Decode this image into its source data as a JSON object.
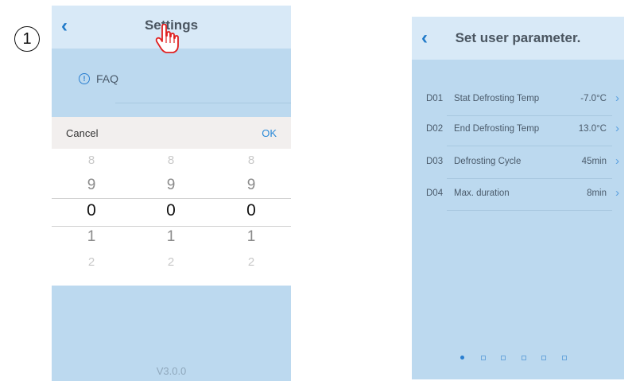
{
  "step_number": "1",
  "left_screen": {
    "title": "Settings",
    "faq_label": "FAQ",
    "picker": {
      "cancel_label": "Cancel",
      "ok_label": "OK",
      "wheels": [
        {
          "values": [
            "8",
            "9",
            "0",
            "1",
            "2"
          ],
          "selected": "0"
        },
        {
          "values": [
            "8",
            "9",
            "0",
            "1",
            "2"
          ],
          "selected": "0"
        },
        {
          "values": [
            "8",
            "9",
            "0",
            "1",
            "2"
          ],
          "selected": "0"
        }
      ]
    },
    "version": "V3.0.0"
  },
  "right_screen": {
    "title": "Set user parameter.",
    "params": [
      {
        "code": "D01",
        "name": "Stat Defrosting Temp",
        "value": "-7.0°C"
      },
      {
        "code": "D02",
        "name": "End Defrosting Temp",
        "value": "13.0°C"
      },
      {
        "code": "D03",
        "name": "Defrosting Cycle",
        "value": "45min"
      },
      {
        "code": "D04",
        "name": "Max. duration",
        "value": "8min"
      }
    ],
    "page_count": 6,
    "active_page": 1
  },
  "colors": {
    "accent": "#2b7fd0",
    "screen_bg": "#bcd9ef",
    "header_bg": "#d8e9f7",
    "cursor": "#e02020"
  }
}
